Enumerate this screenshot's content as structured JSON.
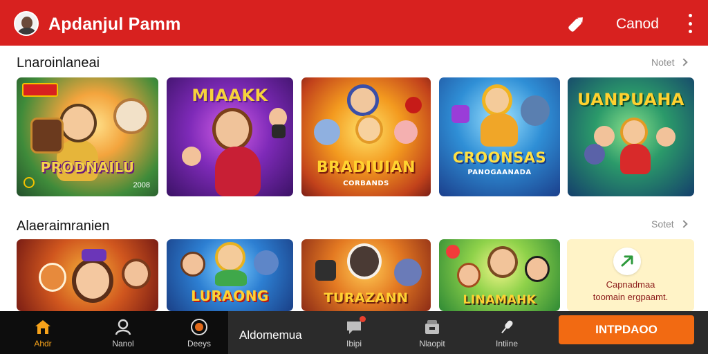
{
  "header": {
    "title": "Apdanjul Pamm",
    "action_label": "Canod",
    "bg_color": "#d8211f"
  },
  "sections": [
    {
      "title": "Lnaroinlaneai",
      "see_all": "Notet",
      "cards": [
        {
          "title": "PRODNAILU",
          "badge": "2008",
          "icon": "shield-icon"
        },
        {
          "title": "MIAAKK",
          "badge": "",
          "icon": "wand-icon"
        },
        {
          "title": "BRADIUIAN",
          "subtitle": "CORBANDS",
          "badge": "",
          "icon": "star-icon"
        },
        {
          "title": "CROONSAS",
          "subtitle": "PANOGAANADA",
          "badge": "",
          "icon": "gem-icon"
        },
        {
          "title": "UANPUAHA",
          "badge": "",
          "icon": "trophy-icon"
        }
      ]
    },
    {
      "title": "Alaeraimranien",
      "see_all": "Sotet",
      "cards": [
        {
          "title": "",
          "badge": "",
          "icon": "fox-icon"
        },
        {
          "title": "LURAONG",
          "badge": "",
          "icon": "gem-icon"
        },
        {
          "title": "TURAZANN",
          "badge": "",
          "icon": "bear-icon"
        },
        {
          "title": "LINAMAHK",
          "badge": "",
          "icon": "leaf-icon"
        }
      ],
      "promo": {
        "line1": "Capnadmaa",
        "line2": "toomain ergpaamt.",
        "icon": "arrow-icon"
      }
    }
  ],
  "bottom_nav": {
    "items": [
      {
        "label": "Ahdr",
        "icon": "home-icon",
        "active": true
      },
      {
        "label": "Nanol",
        "icon": "user-icon",
        "active": false
      },
      {
        "label": "Deeys",
        "icon": "record-icon",
        "active": false
      }
    ],
    "middle_label": "Aldomemua",
    "right_items": [
      {
        "label": "Ibipi",
        "icon": "chat-icon"
      },
      {
        "label": "Nlaopit",
        "icon": "store-icon"
      },
      {
        "label": "Intiine",
        "icon": "microphone-icon"
      }
    ],
    "cta_label": "INTPDAOO",
    "accent_color": "#f26a12"
  }
}
